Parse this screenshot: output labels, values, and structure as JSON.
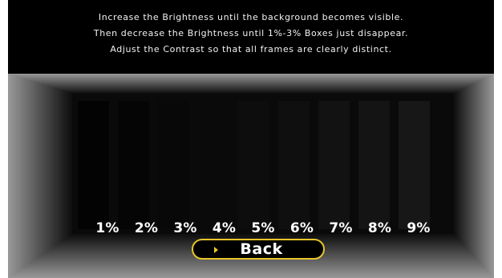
{
  "instructions": {
    "line1": "Increase the Brightness until the background becomes visible.",
    "line2": "Then decrease the Brightness until 1%-3% Boxes just disappear.",
    "line3": "Adjust the Contrast so that all frames are clearly distinct."
  },
  "calibration": {
    "levels": [
      {
        "label": "1%",
        "value": 1
      },
      {
        "label": "2%",
        "value": 2
      },
      {
        "label": "3%",
        "value": 3
      },
      {
        "label": "4%",
        "value": 4
      },
      {
        "label": "5%",
        "value": 5
      },
      {
        "label": "6%",
        "value": 6
      },
      {
        "label": "7%",
        "value": 7
      },
      {
        "label": "8%",
        "value": 8
      },
      {
        "label": "9%",
        "value": 9
      }
    ]
  },
  "back_button": {
    "label": "Back",
    "icon": "play-arrow-icon"
  },
  "colors": {
    "background": "#000000",
    "text": "#ffffff",
    "accent": "#e8c52a"
  }
}
